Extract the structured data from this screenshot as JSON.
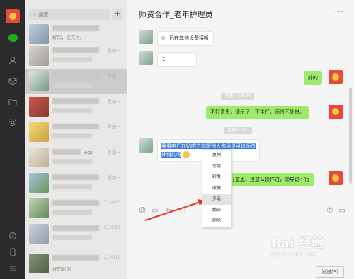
{
  "sidebar": {
    "search_placeholder": "搜索",
    "add_label": "+",
    "conversations": [
      {
        "preview": "好的，您先忙。",
        "time": ""
      },
      {
        "preview": "",
        "time": "星期一"
      },
      {
        "preview": "",
        "time": "星期一"
      },
      {
        "preview": "",
        "time": "星期一"
      },
      {
        "preview": "",
        "time": "星期一"
      },
      {
        "preview": "龙艳",
        "time": "星期一"
      },
      {
        "preview": "",
        "time": "星期一"
      },
      {
        "preview": "",
        "time": "星期一"
      },
      {
        "preview": "",
        "time": "21/4/10"
      },
      {
        "preview": "",
        "time": "21/4/10"
      },
      {
        "preview": "好的谢谢",
        "time": "21/4/10"
      }
    ]
  },
  "chat": {
    "title": "师资合作_老年护理员",
    "more": "···",
    "messages": {
      "other_device": "已在其他设备接听",
      "short": "1",
      "ok": "好的",
      "time1": "星期一 10:04",
      "sorry": "不好意思，请示了一下主任，师资不外借。",
      "time2": "星期一 10:",
      "selected": "我看咱们在贴吧之前跟别人沟通是可以师资",
      "selected2": "外借的呀",
      "reply": "不好意思，没这么操作过，领导说不行"
    },
    "send_label": "发送(S)"
  },
  "context_menu": {
    "items": [
      "复制",
      "引用",
      "转发",
      "收藏",
      "多选",
      "翻译",
      "删除"
    ],
    "highlighted": "多选"
  },
  "watermark": {
    "brand": "Bai 经验",
    "url": "jingyan.baidu.com"
  }
}
